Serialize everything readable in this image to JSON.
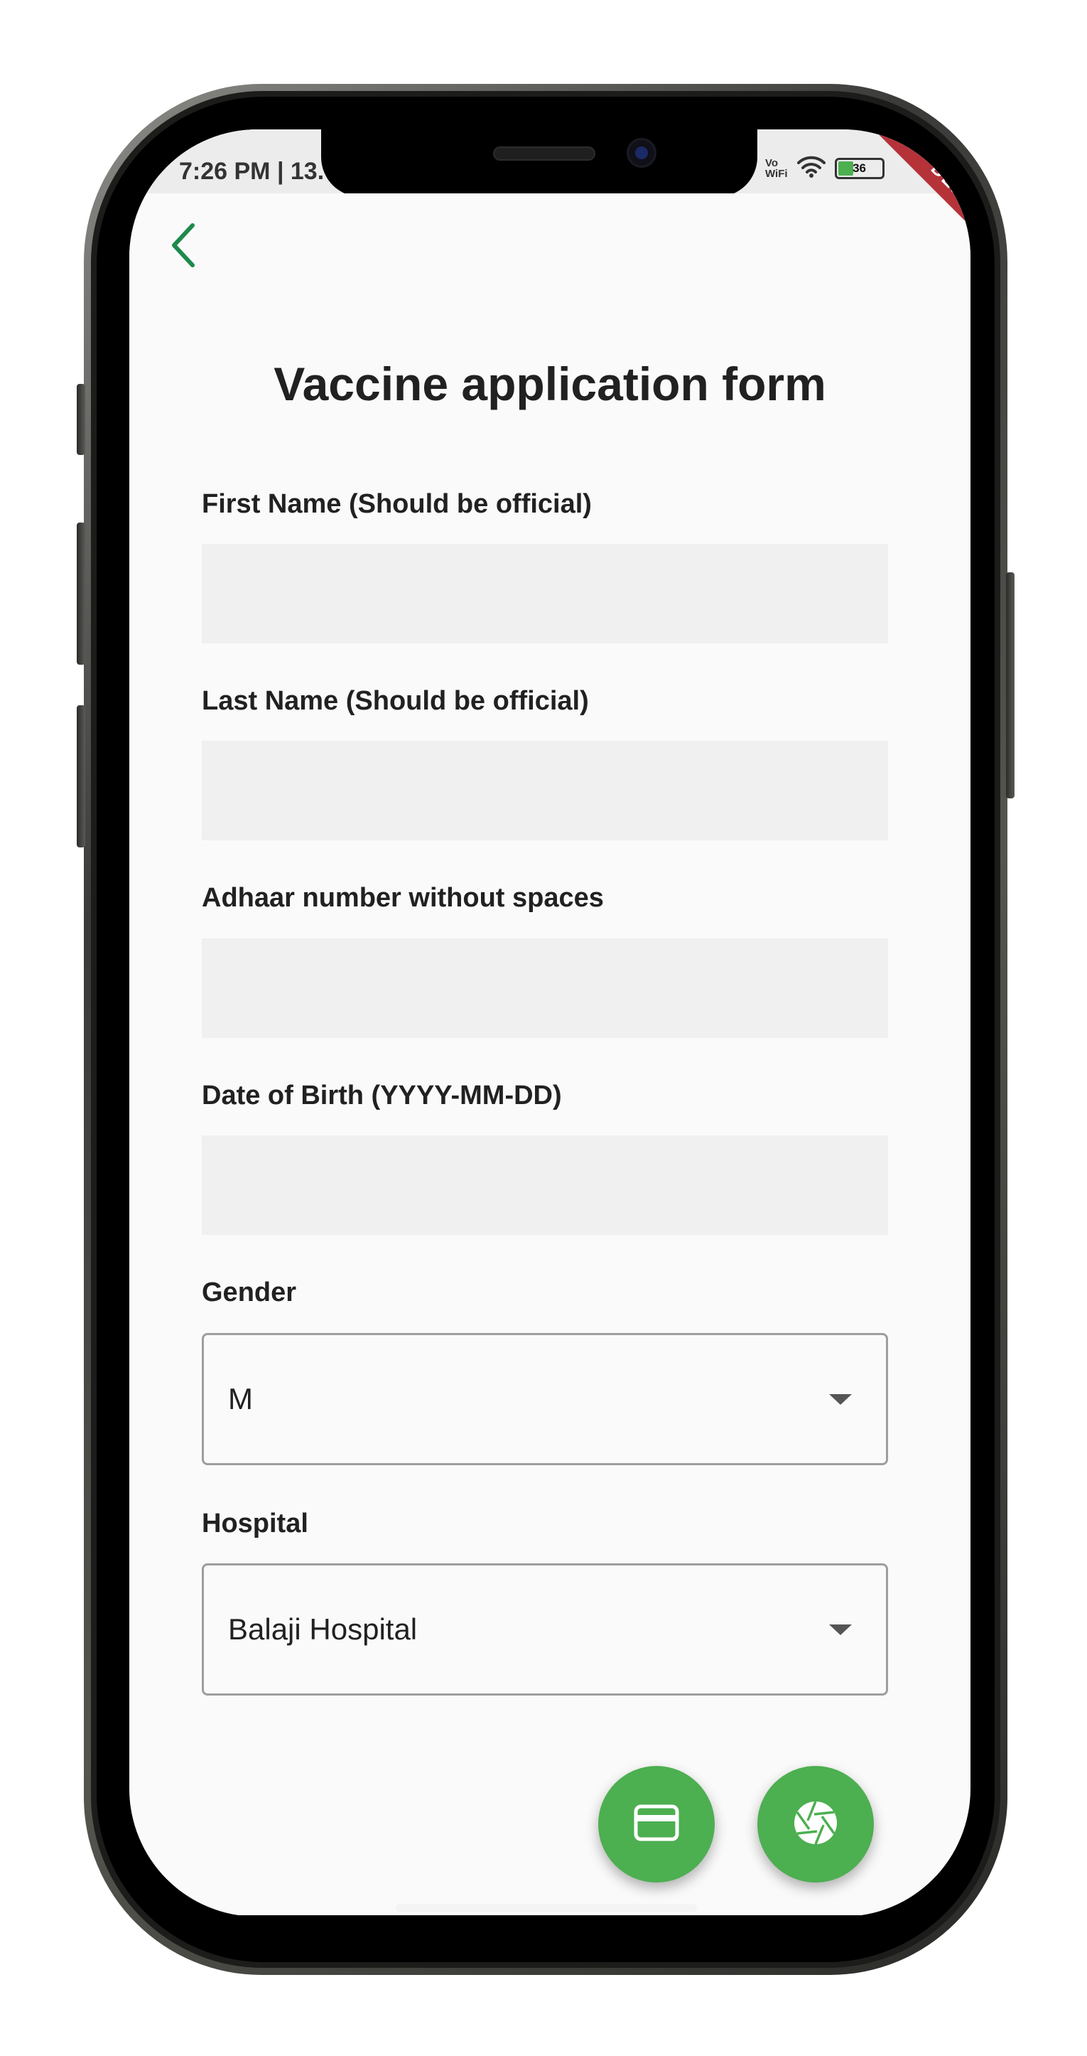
{
  "status_bar": {
    "time": "7:26 PM | 13.",
    "vowifi_top": "Vo",
    "vowifi_bottom": "WiFi",
    "battery": "36",
    "debug_banner": "DEBUG"
  },
  "app_bar": {
    "back_icon": "chevron-left-icon"
  },
  "form": {
    "title": "Vaccine application form",
    "first_name_label": "First Name (Should be official)",
    "first_name_value": "",
    "last_name_label": "Last Name (Should be official)",
    "last_name_value": "",
    "adhaar_label": "Adhaar number without spaces",
    "adhaar_value": "",
    "dob_label": "Date of Birth (YYYY-MM-DD)",
    "dob_value": "",
    "gender_label": "Gender",
    "gender_value": "M",
    "hospital_label": "Hospital",
    "hospital_value": "Balaji Hospital"
  },
  "actions": {
    "card_icon": "credit-card-icon",
    "camera_icon": "camera-shutter-icon"
  },
  "colors": {
    "accent": "#4caf50",
    "back_icon": "#1e8a4c",
    "background": "#fafafa",
    "field_fill": "#f0f0f0",
    "debug_ribbon": "#b0222a"
  }
}
